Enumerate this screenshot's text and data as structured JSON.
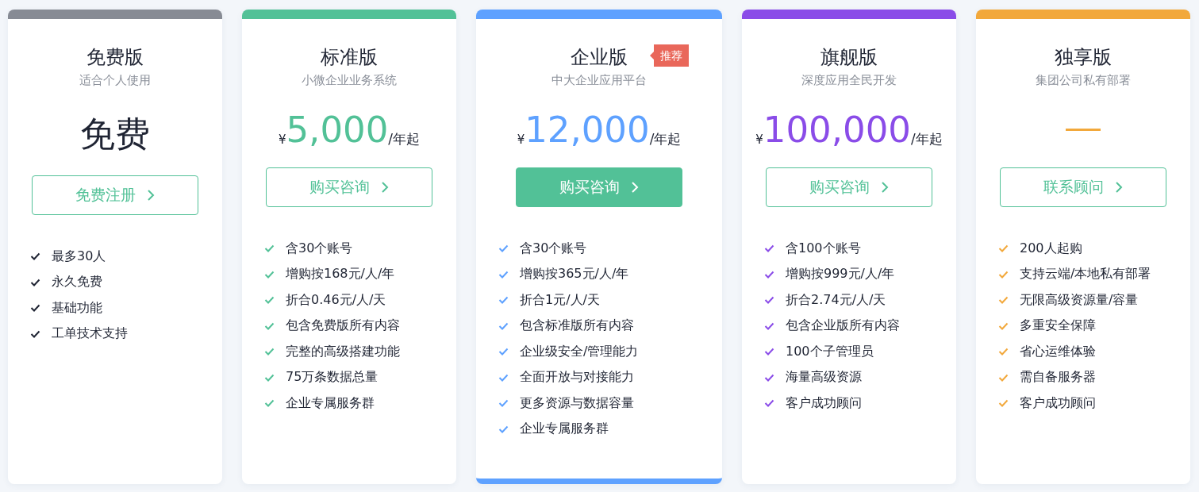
{
  "plans": [
    {
      "title": "免费版",
      "subtitle": "适合个人使用",
      "color": "#878b94",
      "featured": false,
      "price": {
        "kind": "text",
        "text": "免费"
      },
      "button": {
        "label": "免费注册",
        "primary": false
      },
      "features": [
        "最多30人",
        "永久免费",
        "基础功能",
        "工单技术支持"
      ]
    },
    {
      "title": "标准版",
      "subtitle": "小微企业业务系统",
      "color": "#52c197",
      "featured": false,
      "price": {
        "kind": "amount",
        "currency": "¥",
        "amount": "5,000",
        "unit": "/年起"
      },
      "button": {
        "label": "购买咨询",
        "primary": false
      },
      "features": [
        "含30个账号",
        "增购按168元/人/年",
        "折合0.46元/人/天",
        "包含免费版所有内容",
        "完整的高级搭建功能",
        "75万条数据总量",
        "企业专属服务群"
      ]
    },
    {
      "title": "企业版",
      "subtitle": "中大企业应用平台",
      "color": "#5ea1ff",
      "featured": true,
      "badge": "推荐",
      "price": {
        "kind": "amount",
        "currency": "¥",
        "amount": "12,000",
        "unit": "/年起"
      },
      "button": {
        "label": "购买咨询",
        "primary": true
      },
      "features": [
        "含30个账号",
        "增购按365元/人/年",
        "折合1元/人/天",
        "包含标准版所有内容",
        "企业级安全/管理能力",
        "全面开放与对接能力",
        "更多资源与数据容量",
        "企业专属服务群"
      ]
    },
    {
      "title": "旗舰版",
      "subtitle": "深度应用全民开发",
      "color": "#8a4ce8",
      "featured": false,
      "price": {
        "kind": "amount",
        "currency": "¥",
        "amount": "100,000",
        "unit": "/年起"
      },
      "button": {
        "label": "购买咨询",
        "primary": false
      },
      "features": [
        "含100个账号",
        "增购按999元/人/年",
        "折合2.74元/人/天",
        "包含企业版所有内容",
        "100个子管理员",
        "海量高级资源",
        "客户成功顾问"
      ]
    },
    {
      "title": "独享版",
      "subtitle": "集团公司私有部署",
      "color": "#f2a83b",
      "featured": false,
      "price": {
        "kind": "dash"
      },
      "button": {
        "label": "联系顾问",
        "primary": false
      },
      "features": [
        "200人起购",
        "支持云端/本地私有部署",
        "无限高级资源量/容量",
        "多重安全保障",
        "省心运维体验",
        "需自备服务器",
        "客户成功顾问"
      ]
    }
  ]
}
